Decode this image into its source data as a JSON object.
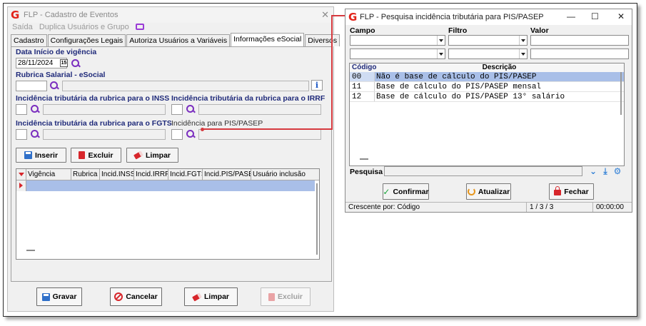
{
  "left_window": {
    "title": "FLP - Cadastro de Eventos",
    "menu": {
      "saida": "Saída",
      "duplica": "Duplica Usuários e Grupo"
    },
    "tabs": [
      "Cadastro",
      "Configurações Legais",
      "Autoriza Usuários a Variáveis",
      "Informações eSocial",
      "Diversos"
    ],
    "form": {
      "data_inicio_label": "Data Início de vigência",
      "data_inicio_value": "28/11/2024",
      "calendar_text": "15",
      "rubrica_label": "Rubrica Salarial - eSocial",
      "info_glyph": "i",
      "inss_label": "Incidência tributária da rubrica para o INSS",
      "irrf_label": "Incidência tributária da rubrica para o IRRF",
      "fgts_label": "Incidência tributária da rubrica para o FGTS",
      "pis_label": "Incidência para PIS/PASEP"
    },
    "buttons": {
      "inserir": "Inserir",
      "excluir": "Excluir",
      "limpar": "Limpar"
    },
    "grid_columns": [
      "Vigência",
      "Rubrica",
      "Incid.INSS",
      "Incid.IRRF",
      "Incid.FGTS",
      "Incid.PIS/PASEP",
      "Usuário inclusão"
    ],
    "footer_buttons": {
      "gravar": "Gravar",
      "cancelar": "Cancelar",
      "limpar": "Limpar",
      "excluir": "Excluir"
    },
    "close_glyph": "✕"
  },
  "right_window": {
    "title": "FLP - Pesquisa incidência tributária para PIS/PASEP",
    "controls": {
      "minimize": "—",
      "maximize": "☐",
      "close": "✕"
    },
    "filter_labels": {
      "campo": "Campo",
      "filtro": "Filtro",
      "valor": "Valor"
    },
    "grid_headers": {
      "codigo": "Código",
      "descricao": "Descrição"
    },
    "rows": [
      {
        "codigo": "00",
        "descricao": "Não é base de cálculo do PIS/PASEP"
      },
      {
        "codigo": "11",
        "descricao": "Base de cálculo do PIS/PASEP mensal"
      },
      {
        "codigo": "12",
        "descricao": "Base de cálculo do PIS/PASEP 13° salário"
      }
    ],
    "search_label": "Pesquisa",
    "buttons": {
      "confirmar": "Confirmar",
      "atualizar": "Atualizar",
      "fechar": "Fechar"
    },
    "status": {
      "order": "Crescente por: Código",
      "count": "1 / 3 / 3",
      "time": "00:00:00"
    }
  },
  "colors": {
    "accent_red": "#d7262b",
    "selection_blue": "#a9bfe8",
    "label_blue": "#1f2a7a",
    "search_purple": "#7b2fbf"
  }
}
